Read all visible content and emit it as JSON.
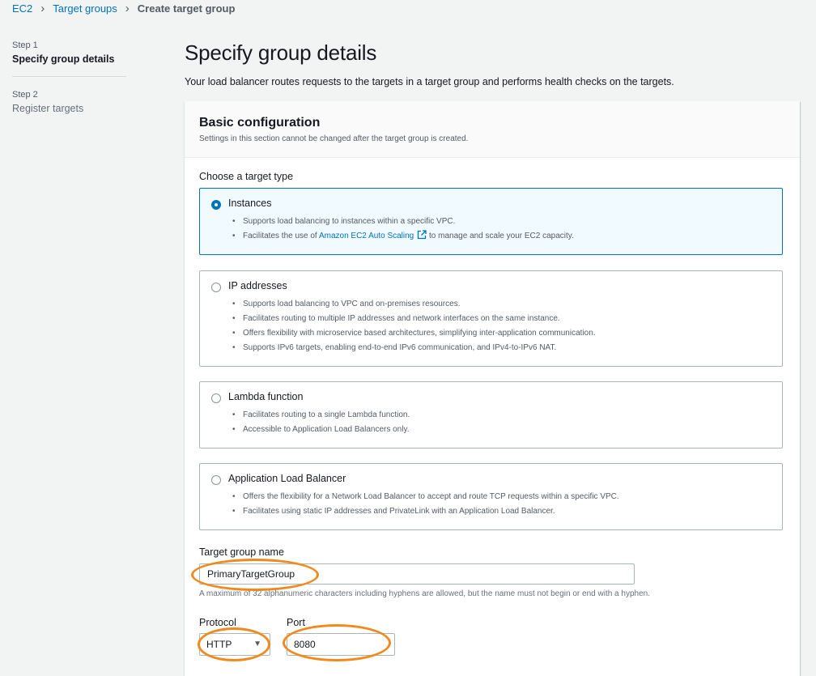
{
  "breadcrumb": {
    "ec2": "EC2",
    "target_groups": "Target groups",
    "current": "Create target group"
  },
  "steps": {
    "step1_num": "Step 1",
    "step1_title": "Specify group details",
    "step2_num": "Step 2",
    "step2_title": "Register targets"
  },
  "page": {
    "title": "Specify group details",
    "description": "Your load balancer routes requests to the targets in a target group and performs health checks on the targets."
  },
  "basic": {
    "title": "Basic configuration",
    "subtitle": "Settings in this section cannot be changed after the target group is created.",
    "target_type_label": "Choose a target type",
    "options": [
      {
        "title": "Instances",
        "selected": true,
        "bullets": [
          "Supports load balancing to instances within a specific VPC."
        ],
        "bullet2_pre": "Facilitates the use of ",
        "bullet2_link": "Amazon EC2 Auto Scaling",
        "bullet2_post": " to manage and scale your EC2 capacity."
      },
      {
        "title": "IP addresses",
        "selected": false,
        "bullets": [
          "Supports load balancing to VPC and on-premises resources.",
          "Facilitates routing to multiple IP addresses and network interfaces on the same instance.",
          "Offers flexibility with microservice based architectures, simplifying inter-application communication.",
          "Supports IPv6 targets, enabling end-to-end IPv6 communication, and IPv4-to-IPv6 NAT."
        ]
      },
      {
        "title": "Lambda function",
        "selected": false,
        "bullets": [
          "Facilitates routing to a single Lambda function.",
          "Accessible to Application Load Balancers only."
        ]
      },
      {
        "title": "Application Load Balancer",
        "selected": false,
        "bullets": [
          "Offers the flexibility for a Network Load Balancer to accept and route TCP requests within a specific VPC.",
          "Facilitates using static IP addresses and PrivateLink with an Application Load Balancer."
        ]
      }
    ],
    "name_label": "Target group name",
    "name_value": "PrimaryTargetGroup",
    "name_hint": "A maximum of 32 alphanumeric characters including hyphens are allowed, but the name must not begin or end with a hyphen.",
    "protocol_label": "Protocol",
    "protocol_value": "HTTP",
    "port_label": "Port",
    "port_value": "8080"
  },
  "colors": {
    "link": "#0073bb",
    "annotation": "#f08a1e"
  },
  "icons": {
    "external_link": "external-link-icon",
    "separator": "chevron-right-icon",
    "caret": "caret-down-icon"
  }
}
